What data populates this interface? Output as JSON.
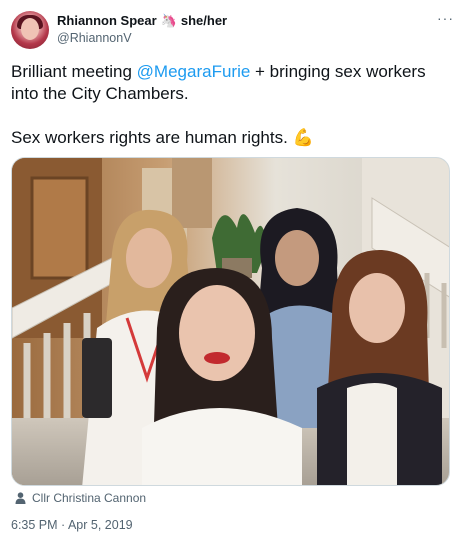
{
  "author": {
    "name": "Rhiannon Spear",
    "name_emoji": "🦄",
    "pronouns": "she/her",
    "handle": "@RhiannonV"
  },
  "menu": {
    "more_label": "···"
  },
  "tweet": {
    "line1_pre": "Brilliant meeting ",
    "line1_mention": "@MegaraFurie",
    "line1_post": " + bringing sex workers into the City Chambers.",
    "line2": "Sex workers rights are human rights. ",
    "line2_emoji": "💪"
  },
  "media": {
    "tagged_person": "Cllr Christina Cannon",
    "tag_icon": "person-icon"
  },
  "meta": {
    "timestamp": "6:35 PM · Apr 5, 2019"
  },
  "colors": {
    "link": "#1d9bf0",
    "secondary_text": "#536471",
    "text": "#0f1419"
  }
}
